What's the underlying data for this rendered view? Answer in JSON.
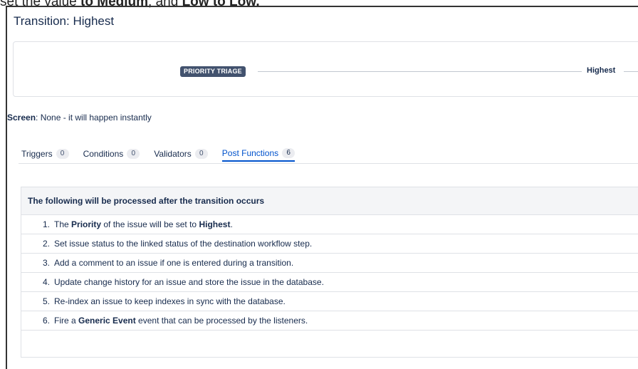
{
  "caption": {
    "pre": "set the value ",
    "b1": "to Medium",
    "mid": ", and ",
    "b2": "Low to Low."
  },
  "page_title": "Transition: Highest",
  "diagram": {
    "from_status": "PRIORITY TRIAGE",
    "to_status": "Highest"
  },
  "screen": {
    "label": "Screen",
    "value": ": None - it will happen instantly"
  },
  "tabs": [
    {
      "label": "Triggers",
      "count": "0"
    },
    {
      "label": "Conditions",
      "count": "0"
    },
    {
      "label": "Validators",
      "count": "0"
    },
    {
      "label": "Post Functions",
      "count": "6",
      "active": true
    }
  ],
  "panel": {
    "header": "The following will be processed after the transition occurs",
    "items": [
      {
        "num": "1.",
        "pre": "The ",
        "b1": "Priority",
        "mid": " of the issue will be set to ",
        "b2": "Highest",
        "post": "."
      },
      {
        "num": "2.",
        "text": "Set issue status to the linked status of the destination workflow step."
      },
      {
        "num": "3.",
        "text": "Add a comment to an issue if one is entered during a transition."
      },
      {
        "num": "4.",
        "text": "Update change history for an issue and store the issue in the database."
      },
      {
        "num": "5.",
        "text": "Re-index an issue to keep indexes in sync with the database."
      },
      {
        "num": "6.",
        "pre": "Fire a ",
        "b1": "Generic Event",
        "post": " event that can be processed by the listeners."
      }
    ]
  },
  "colors": {
    "link_blue": "#0052cc",
    "lozenge_bg": "#42526e",
    "text": "#172b4d",
    "border": "#dfe1e6"
  }
}
